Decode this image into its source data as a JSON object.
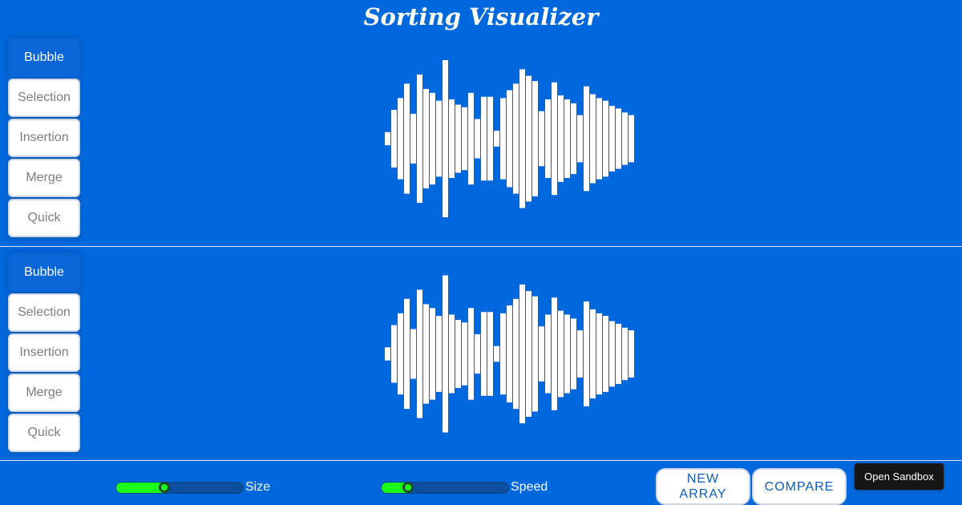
{
  "title": "Sorting Visualizer",
  "colors": {
    "background": "#0068dd",
    "bar": "#ffffff",
    "slider_fill": "#19ff19",
    "button_text": "#0d5cbf"
  },
  "panels": [
    {
      "algorithms": [
        {
          "label": "Bubble",
          "active": true
        },
        {
          "label": "Selection",
          "active": false
        },
        {
          "label": "Insertion",
          "active": false
        },
        {
          "label": "Merge",
          "active": false
        },
        {
          "label": "Quick",
          "active": false
        }
      ]
    },
    {
      "algorithms": [
        {
          "label": "Bubble",
          "active": true
        },
        {
          "label": "Selection",
          "active": false
        },
        {
          "label": "Insertion",
          "active": false
        },
        {
          "label": "Merge",
          "active": false
        },
        {
          "label": "Quick",
          "active": false
        }
      ]
    }
  ],
  "array": [
    10,
    44,
    62,
    84,
    38,
    98,
    76,
    70,
    58,
    120,
    60,
    52,
    48,
    70,
    30,
    64,
    64,
    12,
    62,
    74,
    84,
    106,
    96,
    88,
    42,
    60,
    86,
    66,
    60,
    54,
    36,
    80,
    68,
    62,
    58,
    50,
    46,
    40,
    36
  ],
  "array_max": 120,
  "controls": {
    "size_label": "Size",
    "size_value": 0.38,
    "speed_label": "Speed",
    "speed_value": 0.21,
    "new_array_label": "NEW ARRAY",
    "compare_label": "COMPARE",
    "sandbox_label": "Open Sandbox"
  }
}
